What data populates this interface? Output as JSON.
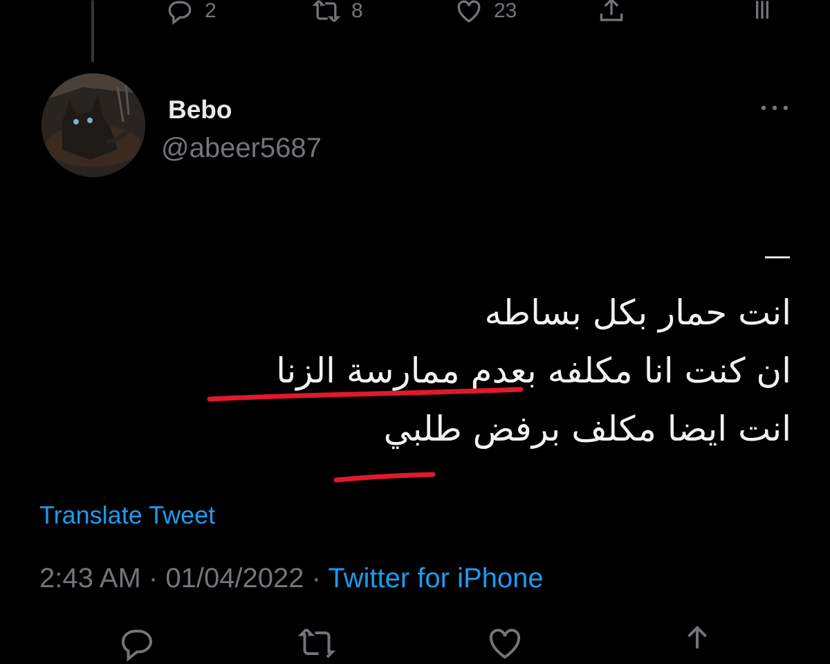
{
  "previous_tweet_actions": {
    "reply_count": "2",
    "retweet_count": "8",
    "like_count": "23"
  },
  "tweet": {
    "display_name": "Bebo",
    "handle": "@abeer5687",
    "body_lines": [
      "—",
      "انت حمار بكل بساطه",
      "ان كنت انا مكلفه بعدم ممارسة الزنا",
      "انت ايضا مكلف برفض طلبي"
    ],
    "translate_label": "Translate Tweet",
    "time": "2:43 AM",
    "separator": "·",
    "date": "01/04/2022",
    "source": "Twitter for iPhone"
  },
  "colors": {
    "background": "#000000",
    "text": "#e7e9ea",
    "muted": "#71767b",
    "accent": "#1d9bf0",
    "annotation_red": "#e0192d"
  },
  "icons": [
    "reply-icon",
    "retweet-icon",
    "like-icon",
    "share-icon",
    "analytics-icon",
    "more-icon"
  ]
}
